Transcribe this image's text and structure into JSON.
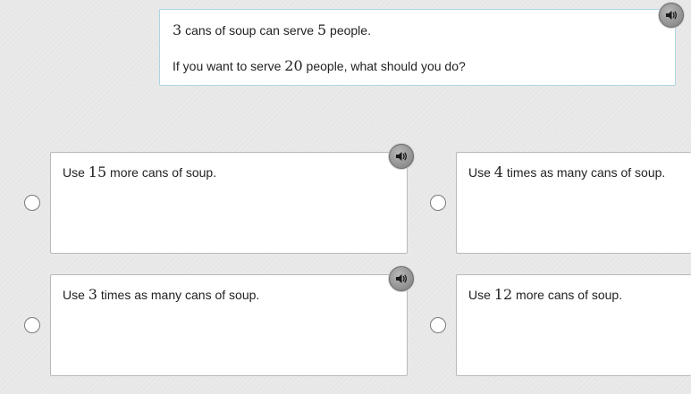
{
  "question": {
    "line1": {
      "num1": "3",
      "text1": " cans of soup can serve ",
      "num2": "5",
      "text2": " people."
    },
    "line2": {
      "text1": "If you want to serve ",
      "num1": "20",
      "text2": " people, what should you do?"
    },
    "audio_icon": "speaker-icon"
  },
  "choices": [
    {
      "prefix": "Use ",
      "num": "15",
      "suffix": " more cans of soup.",
      "has_audio": true
    },
    {
      "prefix": "Use ",
      "num": "4",
      "suffix": " times as many cans of soup.",
      "has_audio": false
    },
    {
      "prefix": "Use ",
      "num": "3",
      "suffix": " times as many cans of soup.",
      "has_audio": true
    },
    {
      "prefix": "Use ",
      "num": "12",
      "suffix": " more cans of soup.",
      "has_audio": false
    }
  ],
  "colors": {
    "background": "#e9e9e9",
    "question_border": "#a9d6e2",
    "card_border": "#b9b9b9",
    "audio_button": "#8e8e8e"
  }
}
